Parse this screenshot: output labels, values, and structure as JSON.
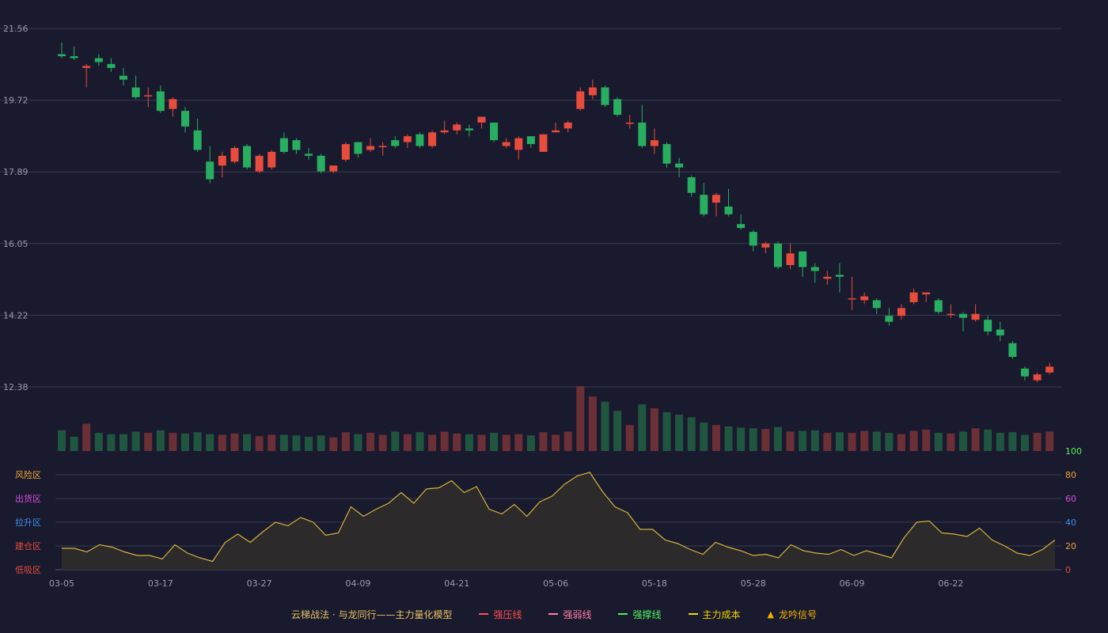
{
  "chart_data": {
    "type": "candlestick",
    "price_axis": {
      "ticks": [
        "21.56",
        "19.72",
        "17.89",
        "16.05",
        "14.22",
        "12.38"
      ],
      "ylim": [
        12.38,
        21.56
      ]
    },
    "x_ticks": [
      "03-05",
      "03-17",
      "03-27",
      "04-09",
      "04-21",
      "05-06",
      "05-18",
      "05-28",
      "06-09",
      "06-22"
    ],
    "x_tick_index": [
      0,
      8,
      16,
      24,
      32,
      40,
      48,
      56,
      64,
      72
    ],
    "candles": [
      [
        20.9,
        20.85,
        21.2,
        20.8
      ],
      [
        20.85,
        20.8,
        21.1,
        20.75
      ],
      [
        20.55,
        20.6,
        20.65,
        20.05
      ],
      [
        20.8,
        20.7,
        20.9,
        20.6
      ],
      [
        20.65,
        20.55,
        20.8,
        20.45
      ],
      [
        20.35,
        20.25,
        20.55,
        20.1
      ],
      [
        20.05,
        19.8,
        20.35,
        19.75
      ],
      [
        19.85,
        19.85,
        20.05,
        19.55
      ],
      [
        19.95,
        19.45,
        20.1,
        19.4
      ],
      [
        19.5,
        19.75,
        19.8,
        19.3
      ],
      [
        19.45,
        19.05,
        19.55,
        18.9
      ],
      [
        18.95,
        18.45,
        19.25,
        18.4
      ],
      [
        18.15,
        17.7,
        18.55,
        17.6
      ],
      [
        18.05,
        18.3,
        18.4,
        17.75
      ],
      [
        18.15,
        18.5,
        18.55,
        18.1
      ],
      [
        18.55,
        18.0,
        18.6,
        17.95
      ],
      [
        17.9,
        18.3,
        18.35,
        17.85
      ],
      [
        18.0,
        18.4,
        18.45,
        17.95
      ],
      [
        18.75,
        18.4,
        18.9,
        18.35
      ],
      [
        18.7,
        18.45,
        18.75,
        18.35
      ],
      [
        18.35,
        18.3,
        18.5,
        18.2
      ],
      [
        18.3,
        17.9,
        18.35,
        17.85
      ],
      [
        17.9,
        18.05,
        18.05,
        17.85
      ],
      [
        18.2,
        18.6,
        18.65,
        18.15
      ],
      [
        18.65,
        18.35,
        18.65,
        18.25
      ],
      [
        18.45,
        18.55,
        18.75,
        18.4
      ],
      [
        18.55,
        18.55,
        18.65,
        18.3
      ],
      [
        18.7,
        18.55,
        18.8,
        18.5
      ],
      [
        18.65,
        18.8,
        18.85,
        18.5
      ],
      [
        18.85,
        18.55,
        18.9,
        18.5
      ],
      [
        18.55,
        18.9,
        18.95,
        18.5
      ],
      [
        18.9,
        18.95,
        19.2,
        18.85
      ],
      [
        18.95,
        19.1,
        19.15,
        18.85
      ],
      [
        19.0,
        18.95,
        19.1,
        18.8
      ],
      [
        19.15,
        19.3,
        19.3,
        19.0
      ],
      [
        19.15,
        18.7,
        19.15,
        18.65
      ],
      [
        18.55,
        18.65,
        18.75,
        18.5
      ],
      [
        18.45,
        18.75,
        18.8,
        18.2
      ],
      [
        18.8,
        18.6,
        18.8,
        18.5
      ],
      [
        18.4,
        18.85,
        18.85,
        18.4
      ],
      [
        18.9,
        18.95,
        19.15,
        18.9
      ],
      [
        19.0,
        19.15,
        19.2,
        18.9
      ],
      [
        19.5,
        19.95,
        20.05,
        19.45
      ],
      [
        19.85,
        20.05,
        20.25,
        19.75
      ],
      [
        20.05,
        19.6,
        20.1,
        19.55
      ],
      [
        19.75,
        19.35,
        19.8,
        19.3
      ],
      [
        19.15,
        19.15,
        19.35,
        19.0
      ],
      [
        19.15,
        18.55,
        19.6,
        18.5
      ],
      [
        18.55,
        18.7,
        19.0,
        18.35
      ],
      [
        18.6,
        18.1,
        18.65,
        18.0
      ],
      [
        18.1,
        18.0,
        18.25,
        17.75
      ],
      [
        17.75,
        17.35,
        17.8,
        17.25
      ],
      [
        17.3,
        16.8,
        17.6,
        16.75
      ],
      [
        17.1,
        17.3,
        17.35,
        16.75
      ],
      [
        17.0,
        16.8,
        17.45,
        16.75
      ],
      [
        16.55,
        16.45,
        16.8,
        16.4
      ],
      [
        16.35,
        16.0,
        16.4,
        15.85
      ],
      [
        15.95,
        16.05,
        16.1,
        15.8
      ],
      [
        16.05,
        15.45,
        16.1,
        15.4
      ],
      [
        15.5,
        15.8,
        16.05,
        15.4
      ],
      [
        15.85,
        15.45,
        15.85,
        15.2
      ],
      [
        15.45,
        15.35,
        15.55,
        15.05
      ],
      [
        15.15,
        15.2,
        15.35,
        15.0
      ],
      [
        15.25,
        15.2,
        15.55,
        14.8
      ],
      [
        14.65,
        14.65,
        15.2,
        14.35
      ],
      [
        14.6,
        14.7,
        14.8,
        14.5
      ],
      [
        14.6,
        14.4,
        14.65,
        14.25
      ],
      [
        14.2,
        14.05,
        14.4,
        13.95
      ],
      [
        14.2,
        14.4,
        14.5,
        14.1
      ],
      [
        14.55,
        14.8,
        14.9,
        14.5
      ],
      [
        14.75,
        14.8,
        14.8,
        14.55
      ],
      [
        14.6,
        14.3,
        14.65,
        14.25
      ],
      [
        14.25,
        14.25,
        14.5,
        14.15
      ],
      [
        14.25,
        14.15,
        14.3,
        13.8
      ],
      [
        14.1,
        14.25,
        14.5,
        14.05
      ],
      [
        14.1,
        13.8,
        14.2,
        13.7
      ],
      [
        13.85,
        13.7,
        14.05,
        13.55
      ],
      [
        13.5,
        13.15,
        13.55,
        13.1
      ],
      [
        12.85,
        12.65,
        12.9,
        12.55
      ],
      [
        12.55,
        12.7,
        12.75,
        12.5
      ],
      [
        12.75,
        12.9,
        13.0,
        12.7
      ]
    ],
    "volume": [
      32,
      22,
      42,
      28,
      26,
      26,
      30,
      28,
      32,
      28,
      27,
      29,
      26,
      25,
      27,
      26,
      23,
      25,
      25,
      24,
      22,
      24,
      21,
      29,
      26,
      28,
      25,
      30,
      26,
      29,
      25,
      30,
      27,
      26,
      25,
      28,
      25,
      26,
      24,
      29,
      25,
      30,
      100,
      84,
      76,
      62,
      40,
      72,
      66,
      60,
      56,
      52,
      44,
      40,
      38,
      36,
      35,
      34,
      37,
      30,
      31,
      32,
      28,
      29,
      28,
      31,
      30,
      28,
      26,
      31,
      33,
      28,
      27,
      30,
      35,
      33,
      28,
      29,
      25,
      28,
      30
    ],
    "indicator": {
      "ylim": [
        0,
        100
      ],
      "ticks": [
        "100",
        "80",
        "60",
        "40",
        "20",
        "0"
      ],
      "zone_labels": [
        "风险区",
        "出货区",
        "拉升区",
        "建仓区",
        "低吸区"
      ],
      "values": [
        18,
        18,
        15,
        21,
        19,
        15,
        12,
        12,
        9,
        21,
        14,
        10,
        7,
        23,
        30,
        23,
        32,
        40,
        37,
        44,
        40,
        29,
        31,
        53,
        45,
        51,
        56,
        65,
        56,
        68,
        69,
        75,
        65,
        70,
        51,
        47,
        55,
        45,
        57,
        62,
        72,
        79,
        82,
        66,
        53,
        48,
        34,
        34,
        25,
        22,
        17,
        13,
        23,
        19,
        16,
        12,
        13,
        10,
        21,
        16,
        14,
        13,
        17,
        12,
        16,
        13,
        10,
        27,
        40,
        41,
        31,
        30,
        28,
        35,
        25,
        20,
        14,
        12,
        17,
        25
      ],
      "fill_color": "#2c2a2a",
      "line_color": "#d4b33b"
    },
    "colors": {
      "up": "#e74c3c",
      "down": "#27ae60",
      "vol_up": "#6b2f36",
      "vol_down": "#20553f"
    },
    "legend": [
      {
        "label": "云梯战法 · 与龙同行——主力量化模型",
        "color": "#e8c064",
        "swatch": "none"
      },
      {
        "label": "强压线",
        "color": "#ff4f4f",
        "swatch": "solid"
      },
      {
        "label": "强弱线",
        "color": "#ff7fa7",
        "swatch": "dashed"
      },
      {
        "label": "强撑线",
        "color": "#4ef25a",
        "swatch": "solid"
      },
      {
        "label": "主力成本",
        "color": "#f5d200",
        "swatch": "dashed"
      },
      {
        "label": "龙吟信号",
        "color": "#f3b200",
        "swatch": "triangle"
      }
    ]
  }
}
